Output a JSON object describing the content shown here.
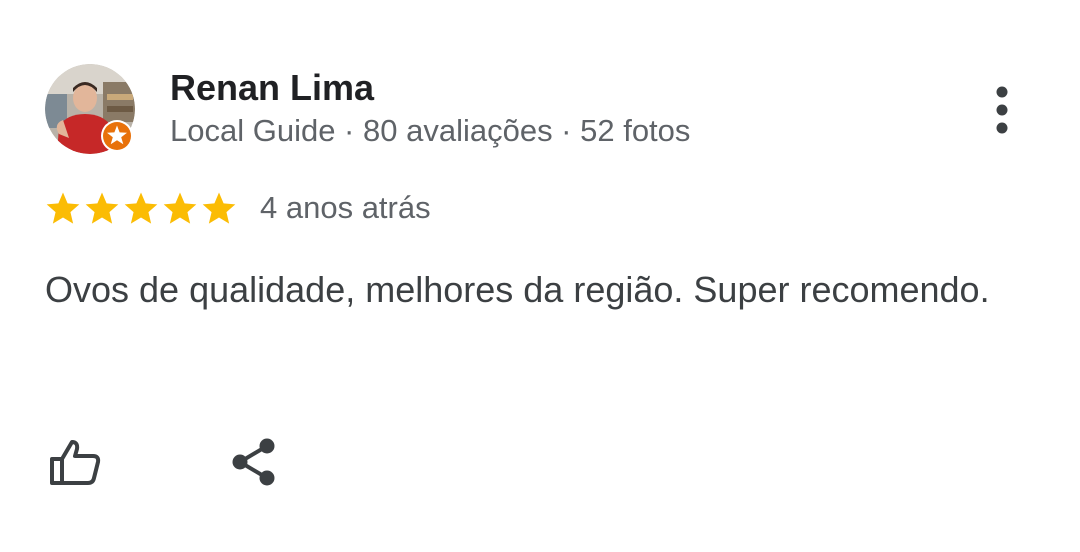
{
  "review": {
    "author": {
      "name": "Renan Lima",
      "meta": "Local Guide · 80 avaliações · 52 fotos",
      "avatar_icon": "user-photo",
      "badge_icon": "local-guide-star-badge",
      "badge_color": "#e8710a"
    },
    "rating": {
      "stars": 5,
      "max_stars": 5,
      "star_color": "#fbbc04"
    },
    "date": "4 anos atrás",
    "text": "Ovos de qualidade, melhores da região. Super recomendo.",
    "actions": {
      "more_icon": "more-vert-icon",
      "like_icon": "thumb-up-icon",
      "share_icon": "share-icon"
    }
  }
}
